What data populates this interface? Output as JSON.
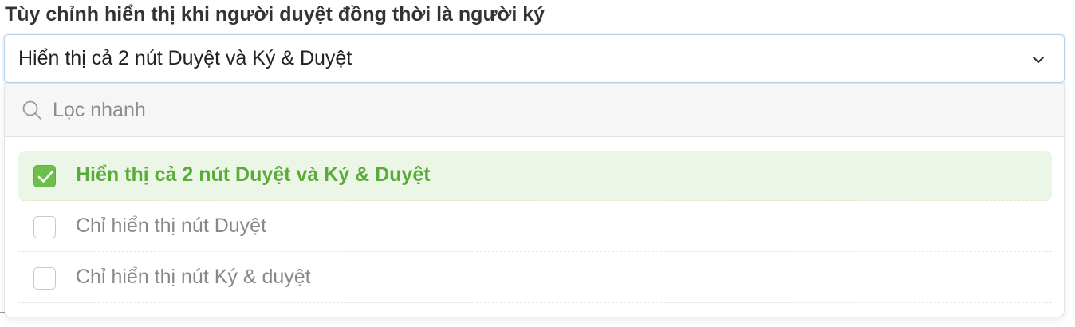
{
  "field": {
    "label": "Tùy chỉnh hiển thị khi người duyệt đồng thời là người ký"
  },
  "select": {
    "value": "Hiển thị cả 2 nút Duyệt và Ký & Duyệt",
    "chevron_icon": "chevron-down-icon"
  },
  "dropdown": {
    "search": {
      "icon": "search-icon",
      "placeholder": "Lọc nhanh",
      "value": ""
    },
    "options": [
      {
        "label": "Hiển thị cả 2 nút Duyệt và Ký & Duyệt",
        "checked": true
      },
      {
        "label": "Chỉ hiển thị nút Duyệt",
        "checked": false
      },
      {
        "label": "Chỉ hiển thị nút Ký & duyệt",
        "checked": false
      }
    ]
  },
  "colors": {
    "selected_text": "#5bab3a",
    "selected_background": "#ebf6e6",
    "checkbox_checked": "#6bbf4a",
    "select_border": "#b9d3ef"
  }
}
